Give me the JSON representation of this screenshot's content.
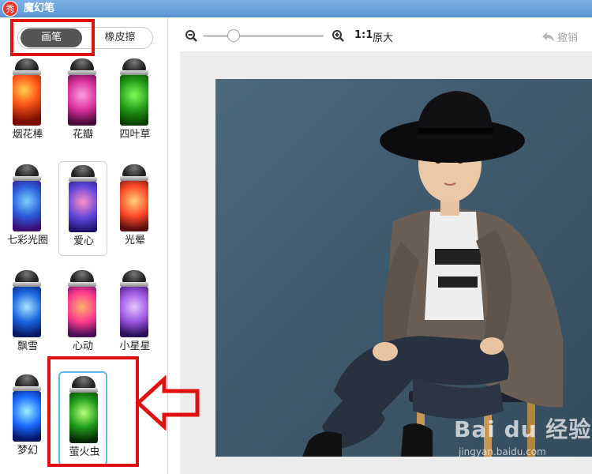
{
  "window": {
    "app_icon": "秀",
    "title": "魔幻笔"
  },
  "tabs": [
    {
      "label": "画笔",
      "active": true
    },
    {
      "label": "橡皮擦",
      "active": false
    }
  ],
  "pens": [
    {
      "label": "烟花棒"
    },
    {
      "label": "花瓣"
    },
    {
      "label": "四叶草"
    },
    {
      "label": "七彩光圈"
    },
    {
      "label": "爱心",
      "selected": true
    },
    {
      "label": "光晕"
    },
    {
      "label": "飘雪"
    },
    {
      "label": "心动"
    },
    {
      "label": "小星星"
    },
    {
      "label": "梦幻"
    },
    {
      "label": "萤火虫",
      "current": true
    }
  ],
  "toolbar": {
    "zoom_out_icon": "zoom-out-icon",
    "zoom_in_icon": "zoom-in-icon",
    "zoom_slider_value": 0.25,
    "zoom_ratio": "1:1",
    "zoom_mode": "原大",
    "undo_label": "撤销"
  },
  "watermark": {
    "logo": "Bai du 经验",
    "url": "jingyan.baidu.com"
  },
  "colors": {
    "titlebar": "#6aa3df",
    "annotation": "#e01010",
    "current_pen_border": "#5cb9ea"
  }
}
